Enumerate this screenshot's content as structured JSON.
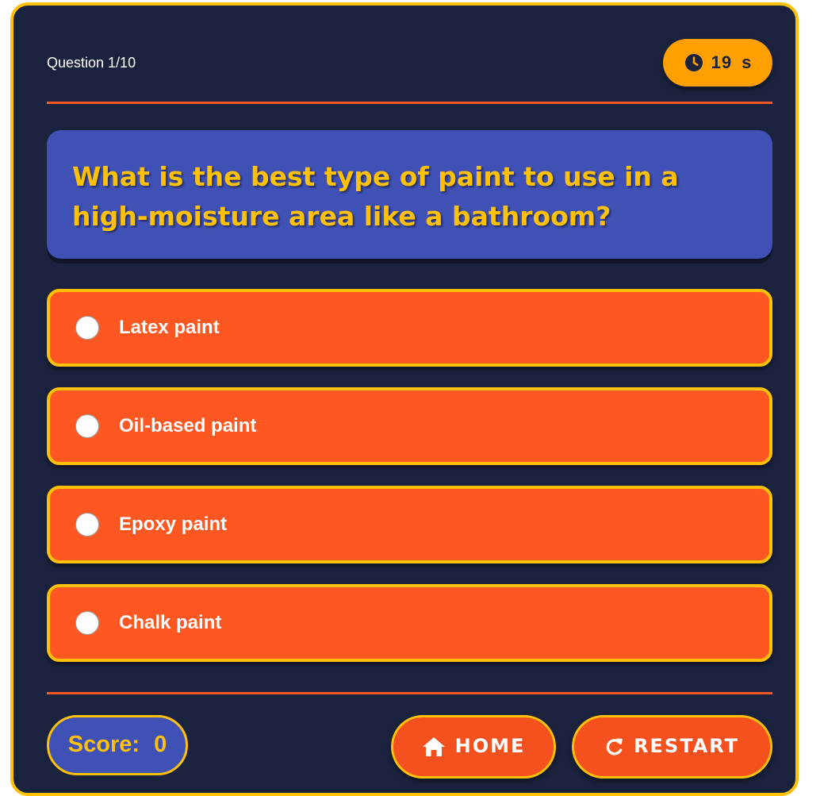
{
  "header": {
    "question_counter": "Question 1/10",
    "timer_value": "19",
    "timer_unit": "s",
    "timer_icon": "clock-icon"
  },
  "question": {
    "text": "What is the best type of paint to use in a high-moisture area like a bathroom?"
  },
  "options": [
    {
      "label": "Latex paint",
      "selected": false
    },
    {
      "label": "Oil-based paint",
      "selected": false
    },
    {
      "label": "Epoxy paint",
      "selected": false
    },
    {
      "label": "Chalk paint",
      "selected": false
    }
  ],
  "footer": {
    "score_label": "Score:",
    "score_value": "0",
    "home_label": "HOME",
    "home_icon": "home-icon",
    "restart_label": "RESTART",
    "restart_icon": "restart-icon"
  },
  "colors": {
    "background": "#1a223d",
    "accent_yellow": "#ffc107",
    "accent_orange": "#ff5722",
    "question_box": "#3f51b5",
    "timer": "#ffa000"
  }
}
